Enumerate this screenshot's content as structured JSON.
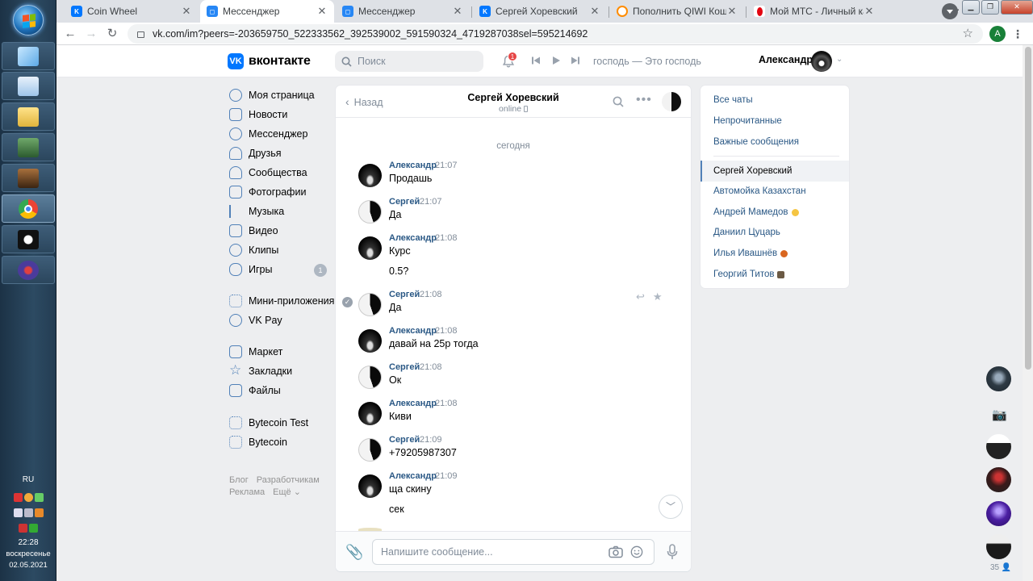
{
  "taskbar": {
    "lang": "RU",
    "clock_time": "22:28",
    "clock_day": "воскресенье",
    "clock_date": "02.05.2021"
  },
  "browser": {
    "tabs": [
      {
        "title": "Coin Wheel",
        "active": false
      },
      {
        "title": "Мессенджер",
        "active": true
      },
      {
        "title": "Мессенджер",
        "active": false
      },
      {
        "title": "Сергей Хоревский",
        "active": false
      },
      {
        "title": "Пополнить QIWI Кошелек",
        "active": false
      },
      {
        "title": "Мой МТС - Личный кабинет",
        "active": false
      }
    ],
    "url": "vk.com/im?peers=-203659750_522333562_392539002_591590324_4719287038sel=595214692",
    "profile_letter": "A"
  },
  "vk_header": {
    "logo_text": "вконтакте",
    "search_placeholder": "Поиск",
    "notif_count": "1",
    "now_playing": "господь — Это господь",
    "user_name": "Александр"
  },
  "left_menu": {
    "items": [
      {
        "label": "Моя страница"
      },
      {
        "label": "Новости"
      },
      {
        "label": "Мессенджер"
      },
      {
        "label": "Друзья"
      },
      {
        "label": "Сообщества"
      },
      {
        "label": "Фотографии"
      },
      {
        "label": "Музыка"
      },
      {
        "label": "Видео"
      },
      {
        "label": "Клипы"
      },
      {
        "label": "Игры",
        "badge": "1"
      },
      {
        "label": "Мини-приложения"
      },
      {
        "label": "VK Pay"
      },
      {
        "label": "Маркет"
      },
      {
        "label": "Закладки"
      },
      {
        "label": "Файлы"
      },
      {
        "label": "Bytecoin Test"
      },
      {
        "label": "Bytecoin"
      }
    ],
    "footer": [
      "Блог",
      "Разработчикам",
      "Реклама",
      "Ещё"
    ]
  },
  "chat": {
    "back_label": "Назад",
    "peer_name": "Сергей Хоревский",
    "peer_status": "online",
    "day_separator": "сегодня",
    "messages": [
      {
        "author": "Александр",
        "time": "21:07",
        "lines": [
          "Продашь"
        ]
      },
      {
        "author": "Сергей",
        "time": "21:07",
        "lines": [
          "Да"
        ]
      },
      {
        "author": "Александр",
        "time": "21:08",
        "lines": [
          "Курс",
          "0.5?"
        ]
      },
      {
        "author": "Сергей",
        "time": "21:08",
        "lines": [
          "Да"
        ]
      },
      {
        "author": "Александр",
        "time": "21:08",
        "lines": [
          "давай на 25р тогда"
        ]
      },
      {
        "author": "Сергей",
        "time": "21:08",
        "lines": [
          "Ок"
        ]
      },
      {
        "author": "Александр",
        "time": "21:08",
        "lines": [
          "Киви"
        ]
      },
      {
        "author": "Сергей",
        "time": "21:09",
        "lines": [
          "+79205987307"
        ]
      },
      {
        "author": "Александр",
        "time": "21:09",
        "lines": [
          "ща скину",
          "сек"
        ]
      }
    ],
    "input_placeholder": "Напишите сообщение..."
  },
  "chat_list": {
    "filters": [
      "Все чаты",
      "Непрочитанные",
      "Важные сообщения"
    ],
    "chats": [
      {
        "name": "Сергей Хоревский",
        "selected": true
      },
      {
        "name": "Автомойка Казахстан"
      },
      {
        "name": "Андрей Мамедов",
        "emoji_color": "#f5c542"
      },
      {
        "name": "Даниил Цуцарь"
      },
      {
        "name": "Илья Ивашнёв",
        "emoji_color": "#d9661f"
      },
      {
        "name": "Георгий Титов",
        "emoji_color": "#6b5a44"
      }
    ]
  },
  "right_rail": {
    "count": "35"
  },
  "colors": {
    "vk_blue": "#0077ff",
    "link": "#2a5885",
    "accent": "#5181b8",
    "bg": "#edeef0"
  }
}
